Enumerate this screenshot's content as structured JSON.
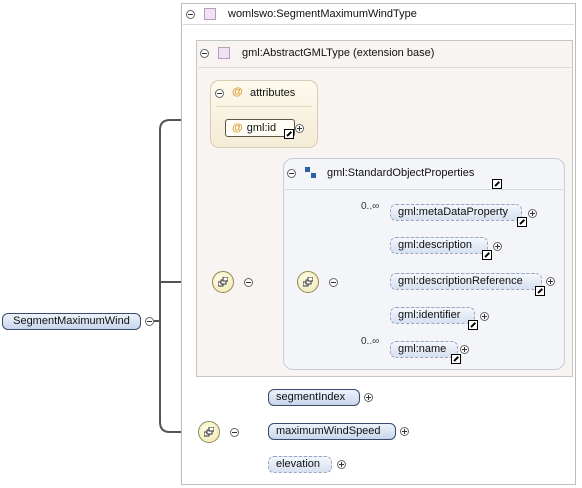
{
  "root": {
    "label": "SegmentMaximumWind"
  },
  "complex_type": {
    "label": "womlswo:SegmentMaximumWindType"
  },
  "extension": {
    "label": "gml:AbstractGMLType (extension base)"
  },
  "attributes": {
    "label": "attributes",
    "items": [
      {
        "label": "gml:id"
      }
    ]
  },
  "standard_props": {
    "label": "gml:StandardObjectProperties"
  },
  "sop_elements": [
    {
      "label": "gml:metaDataProperty",
      "multiplicity": "0..∞"
    },
    {
      "label": "gml:description",
      "multiplicity": ""
    },
    {
      "label": "gml:descriptionReference",
      "multiplicity": ""
    },
    {
      "label": "gml:identifier",
      "multiplicity": ""
    },
    {
      "label": "gml:name",
      "multiplicity": "0..∞"
    }
  ],
  "own_elements": [
    {
      "label": "segmentIndex"
    },
    {
      "label": "maximumWindSpeed"
    },
    {
      "label": "elevation"
    }
  ],
  "icons": [
    "collapse-icon",
    "expand-icon",
    "type-icon",
    "attribute-icon",
    "reference-link-icon",
    "sequence-icon",
    "group-icon"
  ],
  "colors": {
    "element_fill": "#c7d5ec",
    "attribute_accent": "#d79a2e",
    "sequence_fill": "#efe7b4",
    "type_icon": "#f0e2f2"
  }
}
